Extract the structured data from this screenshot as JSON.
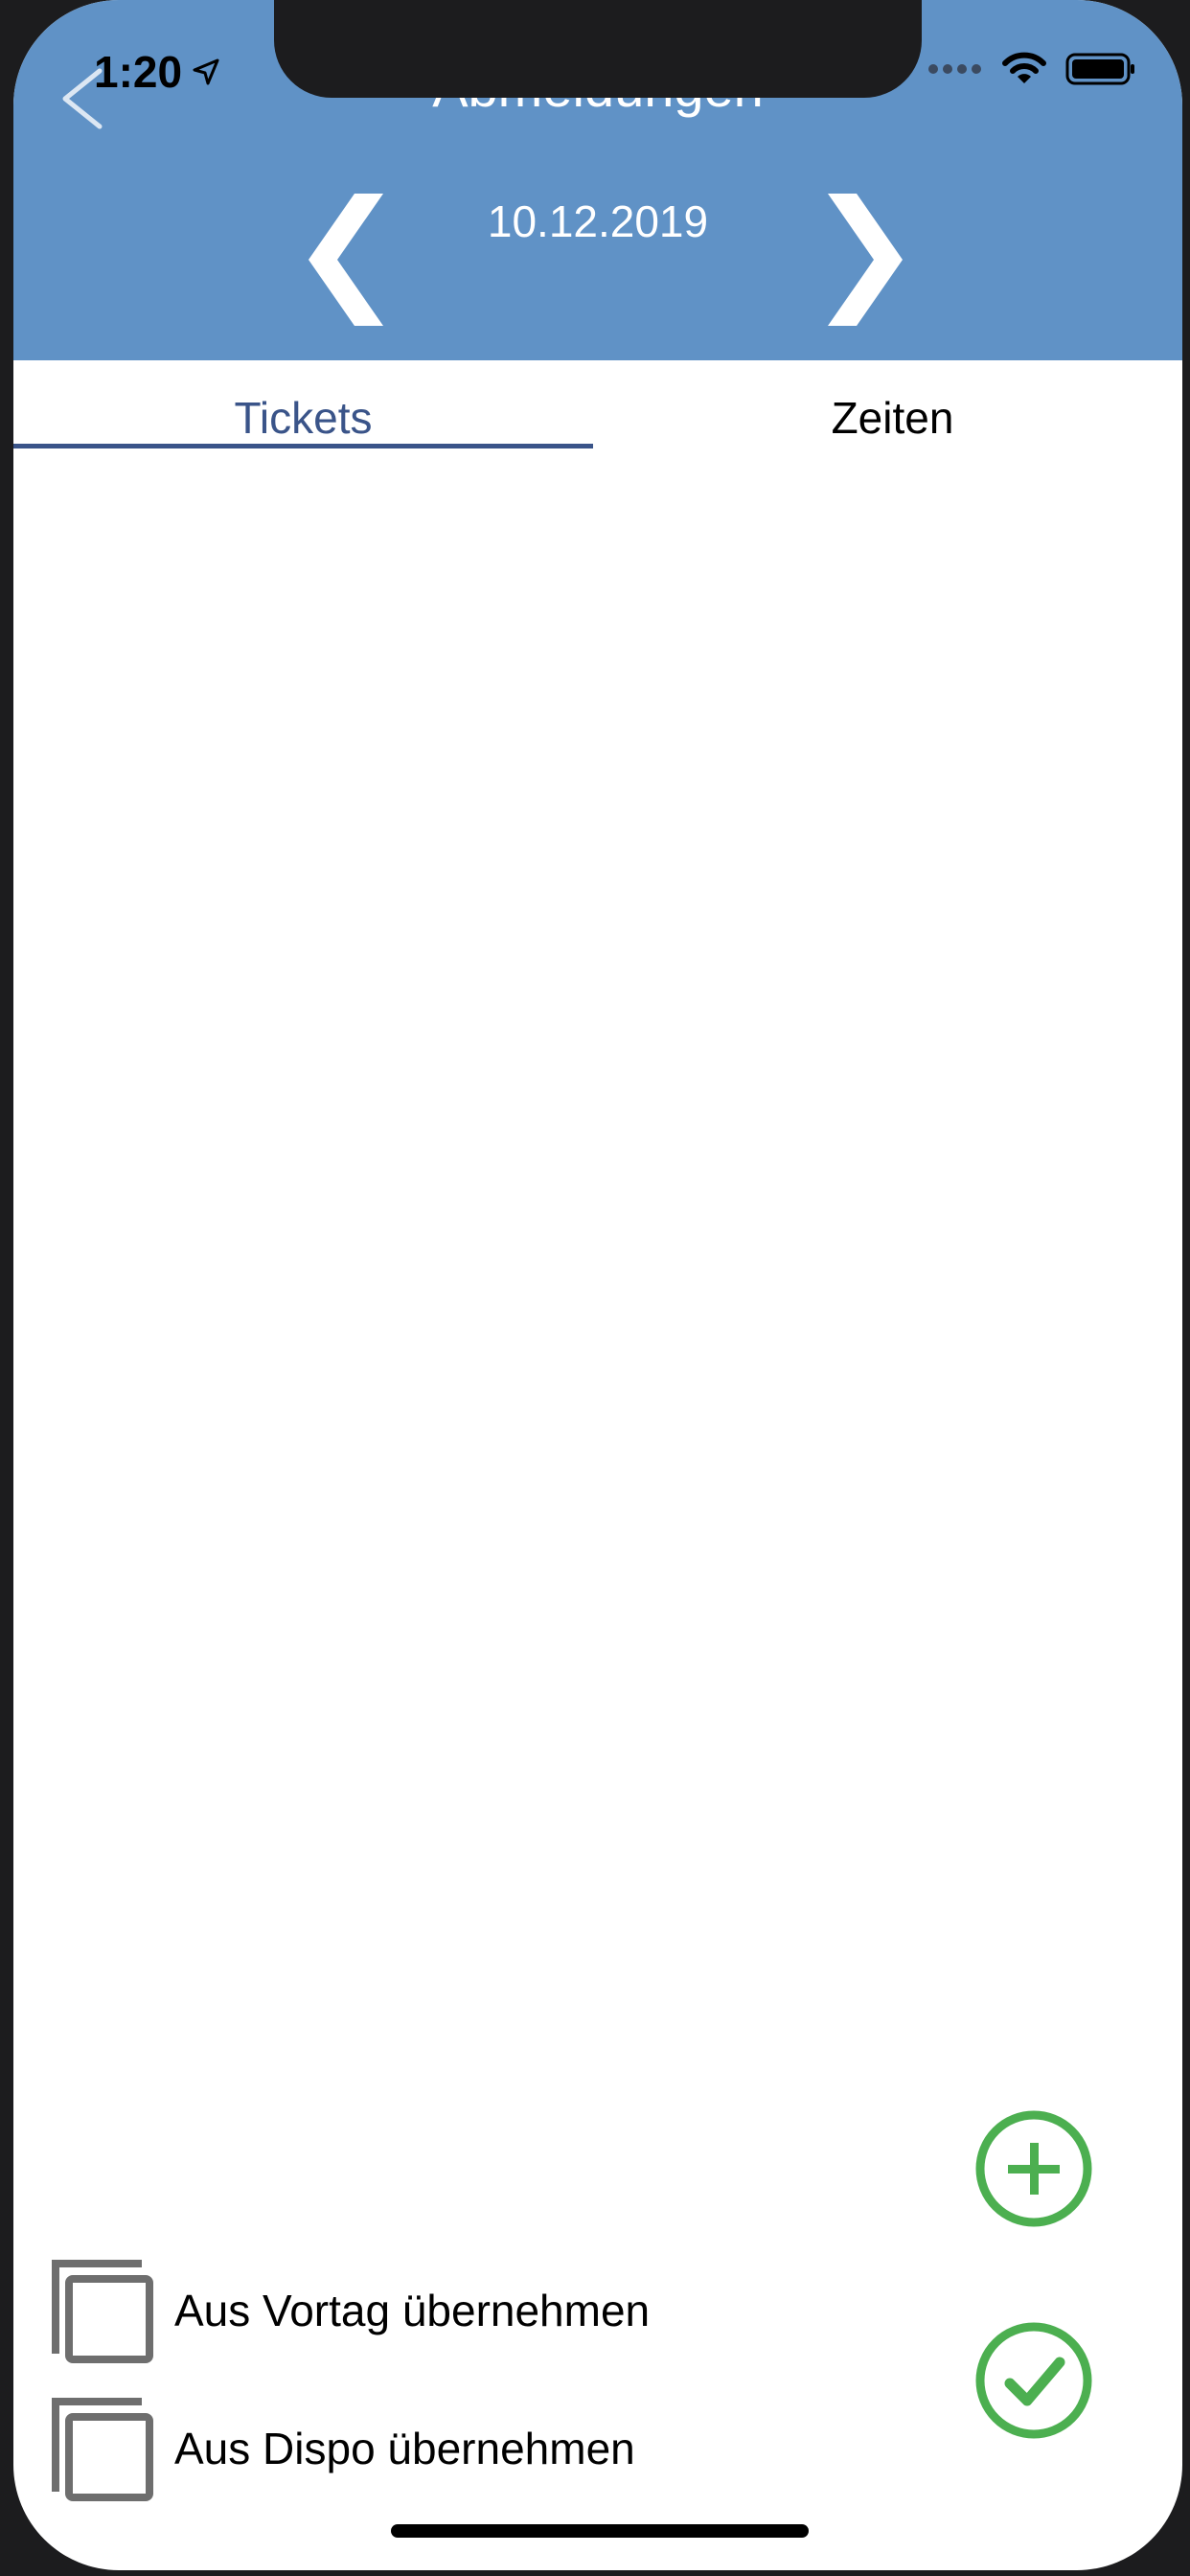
{
  "status_bar": {
    "time": "1:20"
  },
  "header": {
    "title": "Abmeldungen",
    "date": "10.12.2019",
    "colors": {
      "bar": "#6092c6",
      "text": "#ffffff"
    },
    "icons": {
      "back": "back-chevron-icon",
      "prev": "chevron-left-icon",
      "next": "chevron-right-icon"
    }
  },
  "tabs": [
    {
      "label": "Tickets",
      "active": true
    },
    {
      "label": "Zeiten",
      "active": false
    }
  ],
  "colors": {
    "tab_active": "#3a5489",
    "fab": "#4caf50"
  },
  "actions": {
    "copy_previous_day": "Aus Vortag übernehmen",
    "copy_dispo": "Aus Dispo übernehmen"
  },
  "fab_icons": {
    "add": "plus-circle-icon",
    "confirm": "check-circle-icon"
  }
}
